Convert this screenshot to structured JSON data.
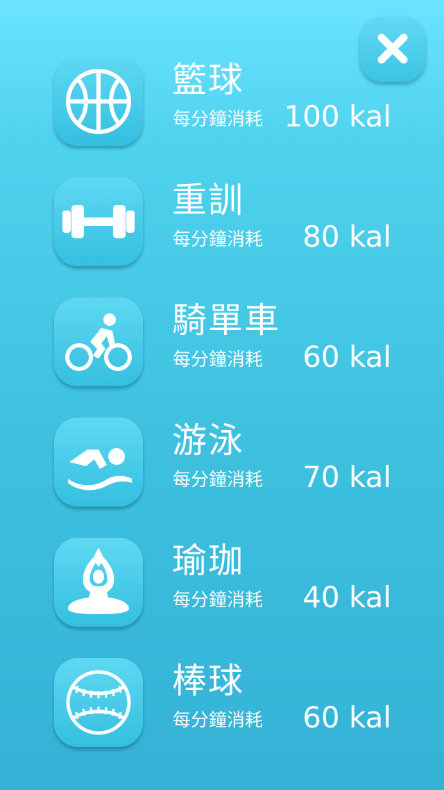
{
  "header": {
    "close_icon": "close-icon"
  },
  "activities": [
    {
      "name": "籃球",
      "per_minute": "每分鐘消耗",
      "calories": "100 kal",
      "icon": "basketball-icon"
    },
    {
      "name": "重訓",
      "per_minute": "每分鐘消耗",
      "calories": "80 kal",
      "icon": "dumbbell-icon"
    },
    {
      "name": "騎單車",
      "per_minute": "每分鐘消耗",
      "calories": "60 kal",
      "icon": "cyclist-icon"
    },
    {
      "name": "游泳",
      "per_minute": "每分鐘消耗",
      "calories": "70 kal",
      "icon": "swimmer-icon"
    },
    {
      "name": "瑜珈",
      "per_minute": "每分鐘消耗",
      "calories": "40 kal",
      "icon": "yoga-icon"
    },
    {
      "name": "棒球",
      "per_minute": "每分鐘消耗",
      "calories": "60 kal",
      "icon": "baseball-icon"
    }
  ],
  "colors": {
    "background_top": "#6be4ff",
    "background_bottom": "#34b2d6",
    "tile": "#3ec4e4",
    "text": "#ffffff"
  }
}
